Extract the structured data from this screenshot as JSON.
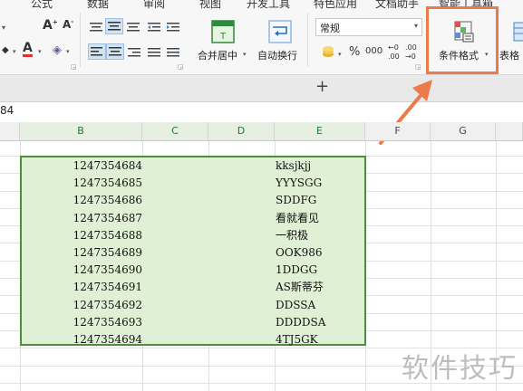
{
  "menu": {
    "items": [
      "公式",
      "数据",
      "审阅",
      "视图",
      "开发工具",
      "特色应用",
      "文档助手",
      "智能工具箱"
    ]
  },
  "ribbon": {
    "merge_label": "合并居中",
    "wrap_label": "自动换行",
    "number_format": "常规",
    "percent_symbol": "%",
    "thousands_symbol": "000",
    "conditional_format_label": "条件格式",
    "table_style_label": "表格"
  },
  "tabbar": {
    "add_symbol": "+"
  },
  "formula_bar": {
    "name_box": "84"
  },
  "grid": {
    "columns": [
      "B",
      "C",
      "D",
      "E",
      "F",
      "G"
    ],
    "selected_columns": [
      "B",
      "C",
      "D",
      "E"
    ],
    "rows": [
      {
        "b": "1247354684",
        "e": "kksjkjj"
      },
      {
        "b": "1247354685",
        "e": "YYYSGG"
      },
      {
        "b": "1247354686",
        "e": "SDDFG"
      },
      {
        "b": "1247354687",
        "e": "看就看见"
      },
      {
        "b": "1247354688",
        "e": "一积极"
      },
      {
        "b": "1247354689",
        "e": "OOK986"
      },
      {
        "b": "1247354690",
        "e": "1DDGG"
      },
      {
        "b": "1247354691",
        "e": "AS斯蒂芬"
      },
      {
        "b": "1247354692",
        "e": "DDSSA"
      },
      {
        "b": "1247354693",
        "e": "DDDDSA"
      },
      {
        "b": "1247354694",
        "e": "4TJ5GK"
      }
    ]
  },
  "watermark": "软件技巧",
  "colors": {
    "selection_fill": "#dff0d4",
    "selection_border": "#4a8f3a",
    "highlight": "#ec7a4a"
  }
}
